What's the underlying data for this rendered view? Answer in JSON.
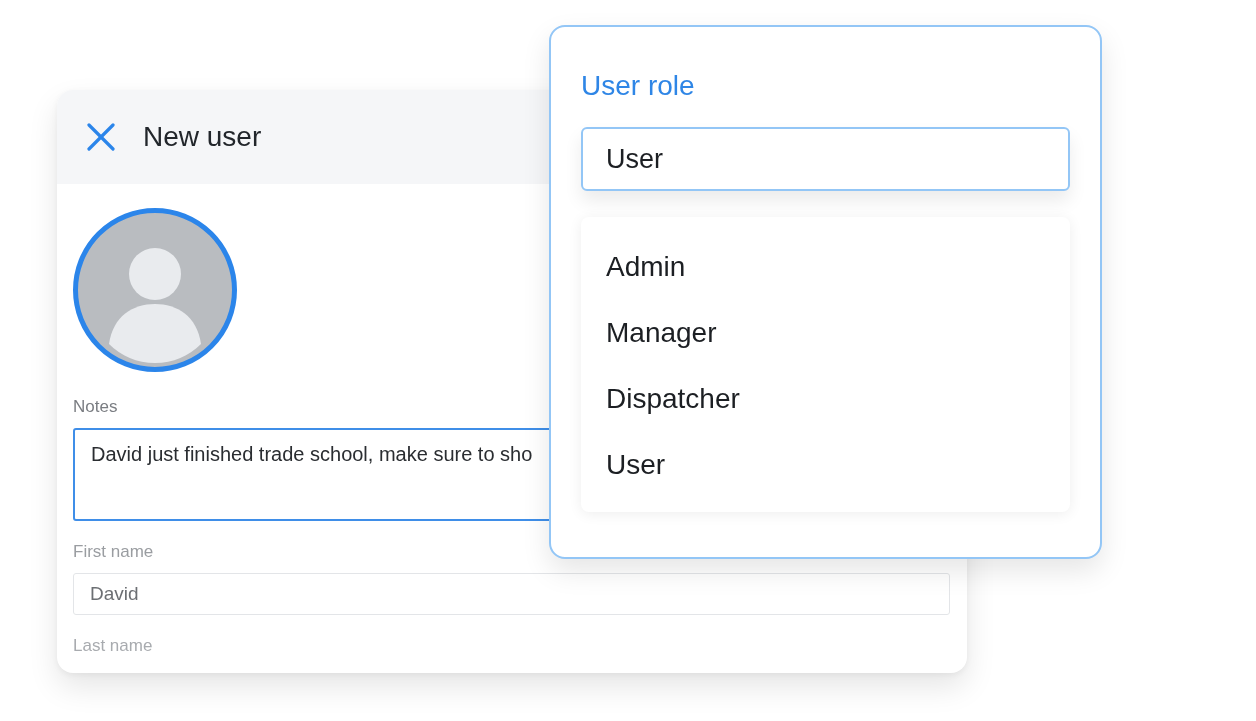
{
  "new_user_panel": {
    "title": "New user",
    "fields": [
      {
        "kind": "textarea",
        "label": "Notes",
        "value": "David just finished trade school, make sure to sho",
        "focused": true
      },
      {
        "kind": "input",
        "label": "First name",
        "value": "David",
        "focused": false
      },
      {
        "kind": "label",
        "label": "Last name"
      }
    ]
  },
  "user_role_popup": {
    "title": "User role",
    "value": "User",
    "focused": true,
    "options": [
      "Admin",
      "Manager",
      "Dispatcher",
      "User"
    ]
  }
}
